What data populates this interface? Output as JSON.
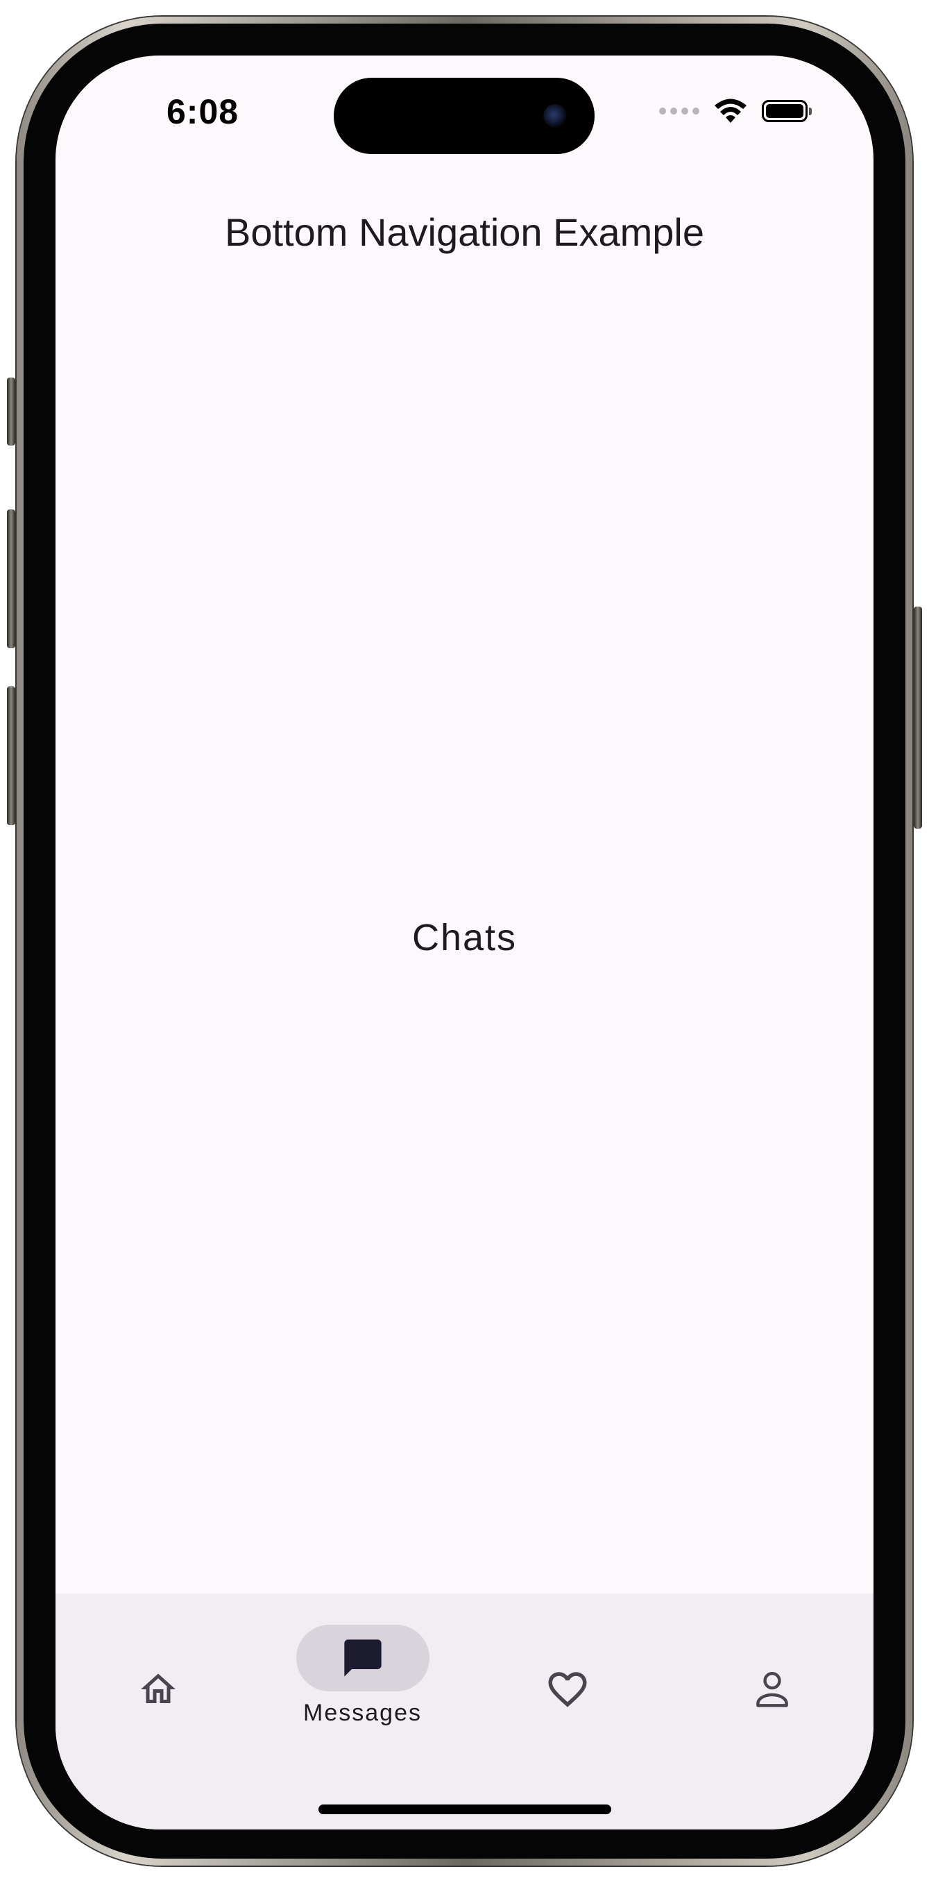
{
  "status_bar": {
    "time": "6:08"
  },
  "app_bar": {
    "title": "Bottom Navigation Example"
  },
  "content": {
    "text": "Chats"
  },
  "bottom_nav": {
    "selected_index": 1,
    "items": [
      {
        "icon": "home-icon",
        "label": ""
      },
      {
        "icon": "message-icon",
        "label": "Messages"
      },
      {
        "icon": "heart-icon",
        "label": ""
      },
      {
        "icon": "person-icon",
        "label": ""
      }
    ]
  },
  "colors": {
    "background": "#fdf8fc",
    "nav_background": "#f2ecf3",
    "active_indicator": "#d9d3dc",
    "icon": "#49454f",
    "text": "#1d1b20"
  }
}
